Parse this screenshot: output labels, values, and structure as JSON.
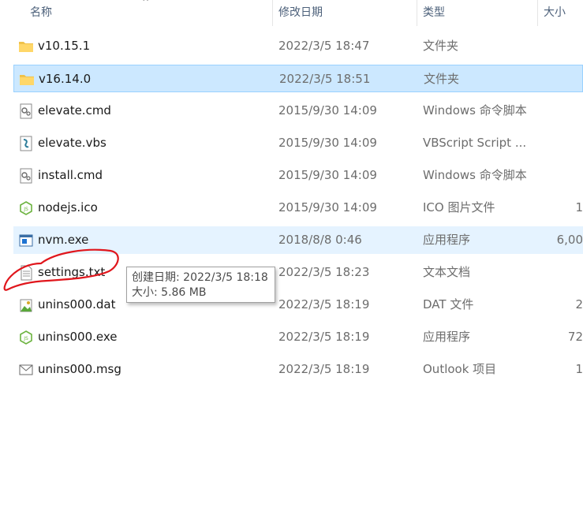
{
  "header": {
    "name": "名称",
    "date": "修改日期",
    "type": "类型",
    "size": "大小",
    "sort_indicator": "^"
  },
  "files": [
    {
      "name": "v10.15.1",
      "date": "2022/3/5 18:47",
      "type": "文件夹",
      "size": "",
      "icon": "folder-icon"
    },
    {
      "name": "v16.14.0",
      "date": "2022/3/5 18:51",
      "type": "文件夹",
      "size": "",
      "icon": "folder-icon"
    },
    {
      "name": "elevate.cmd",
      "date": "2015/9/30 14:09",
      "type": "Windows 命令脚本",
      "size": "",
      "icon": "cmd-script-icon"
    },
    {
      "name": "elevate.vbs",
      "date": "2015/9/30 14:09",
      "type": "VBScript Script ...",
      "size": "",
      "icon": "vbscript-icon"
    },
    {
      "name": "install.cmd",
      "date": "2015/9/30 14:09",
      "type": "Windows 命令脚本",
      "size": "",
      "icon": "cmd-script-icon"
    },
    {
      "name": "nodejs.ico",
      "date": "2015/9/30 14:09",
      "type": "ICO 图片文件",
      "size": "1",
      "icon": "nodejs-icon"
    },
    {
      "name": "nvm.exe",
      "date": "2018/8/8 0:46",
      "type": "应用程序",
      "size": "6,00",
      "icon": "exe-icon"
    },
    {
      "name": "settings.txt",
      "date": "2022/3/5 18:23",
      "type": "文本文档",
      "size": "",
      "icon": "text-file-icon"
    },
    {
      "name": "unins000.dat",
      "date": "2022/3/5 18:19",
      "type": "DAT 文件",
      "size": "2",
      "icon": "dat-file-icon"
    },
    {
      "name": "unins000.exe",
      "date": "2022/3/5 18:19",
      "type": "应用程序",
      "size": "72",
      "icon": "nodejs-icon"
    },
    {
      "name": "unins000.msg",
      "date": "2022/3/5 18:19",
      "type": "Outlook 项目",
      "size": "1",
      "icon": "mail-icon"
    }
  ],
  "selected_row": 1,
  "hovered_row": 6,
  "tooltip": {
    "line1": "创建日期: 2022/3/5 18:18",
    "line2": "大小: 5.86 MB"
  },
  "colors": {
    "selected_bg": "#cce8ff",
    "hover_bg": "#e5f3ff",
    "annotation": "#e0161c"
  }
}
